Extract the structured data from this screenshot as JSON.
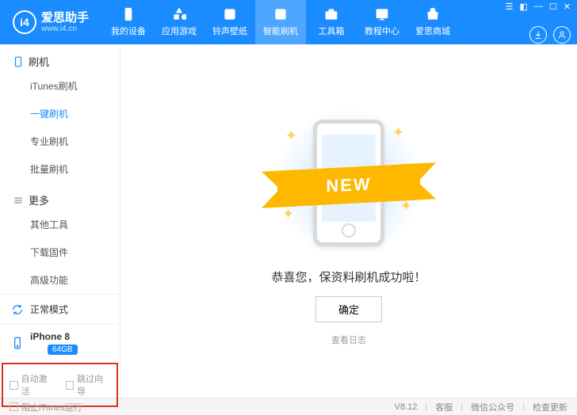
{
  "header": {
    "logo_text": "爱思助手",
    "logo_sub": "www.i4.cn",
    "nav": [
      {
        "icon": "phone",
        "label": "我的设备"
      },
      {
        "icon": "apps",
        "label": "应用游戏"
      },
      {
        "icon": "ring",
        "label": "铃声壁纸"
      },
      {
        "icon": "flash",
        "label": "智能刷机"
      },
      {
        "icon": "toolbox",
        "label": "工具箱"
      },
      {
        "icon": "tutorial",
        "label": "教程中心"
      },
      {
        "icon": "store",
        "label": "爱思商城"
      }
    ],
    "active_nav_index": 3
  },
  "sidebar": {
    "section1": {
      "title": "刷机",
      "items": [
        "iTunes刷机",
        "一键刷机",
        "专业刷机",
        "批量刷机"
      ],
      "active": 1
    },
    "section2": {
      "title": "更多",
      "items": [
        "其他工具",
        "下载固件",
        "高级功能"
      ]
    },
    "mode_label": "正常模式",
    "device_name": "iPhone 8",
    "device_storage": "64GB",
    "checkbox1": "自动激活",
    "checkbox2": "跳过向导"
  },
  "main": {
    "ribbon": "NEW",
    "message": "恭喜您，保资料刷机成功啦！",
    "ok": "确定",
    "log": "查看日志"
  },
  "footer": {
    "block_itunes": "阻止iTunes运行",
    "version": "V8.12",
    "svc": "客服",
    "wechat": "微信公众号",
    "update": "检查更新"
  }
}
